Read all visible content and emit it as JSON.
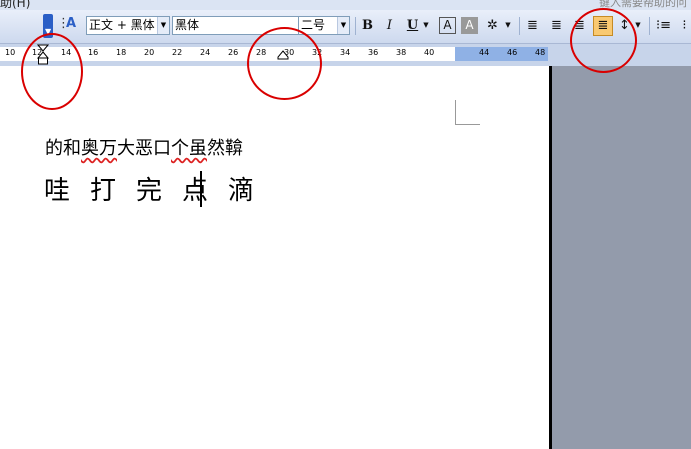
{
  "menu": {
    "help": "助(H)",
    "help_search_placeholder": "键入需要帮助的问"
  },
  "toolbar": {
    "style_value": "正文 + 黑体",
    "font_value": "黑体",
    "size_value": "二号",
    "bold_label": "B",
    "italic_label": "I",
    "underline_label": "U",
    "font_color_label": "A",
    "char_shading_label": "A",
    "active_button": "distributed-align-button",
    "active_color": "#f9c971"
  },
  "ruler": {
    "ticks": [
      "10",
      "12",
      "14",
      "16",
      "18",
      "20",
      "22",
      "24",
      "26",
      "28",
      "30",
      "32",
      "34",
      "36",
      "38",
      "40",
      "44",
      "46",
      "48"
    ]
  },
  "document": {
    "line1": {
      "seg1": "的和",
      "seg2": "奥万",
      "seg3": "大恶口",
      "seg4": "个虽",
      "seg5": "然鞥"
    },
    "line2": "哇打完点滴"
  },
  "annotations": {
    "color": "#d90000"
  }
}
